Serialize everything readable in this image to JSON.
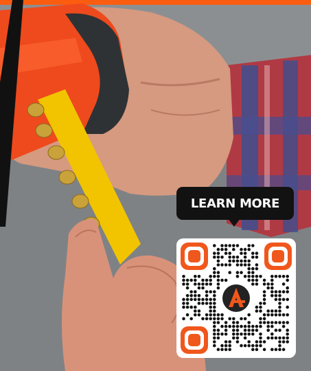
{
  "cta": {
    "label": "LEARN MORE"
  },
  "qr": {
    "logo_letter": "A"
  },
  "colors": {
    "accent_orange": "#f0571c",
    "bar_orange": "#fb5d10",
    "tool_orange": "#ee4a1d",
    "cartridge_yellow": "#f2c400",
    "dark_badge": "#121212",
    "shirt_red": "#b03a44",
    "shirt_blue": "#3e4f8f"
  }
}
